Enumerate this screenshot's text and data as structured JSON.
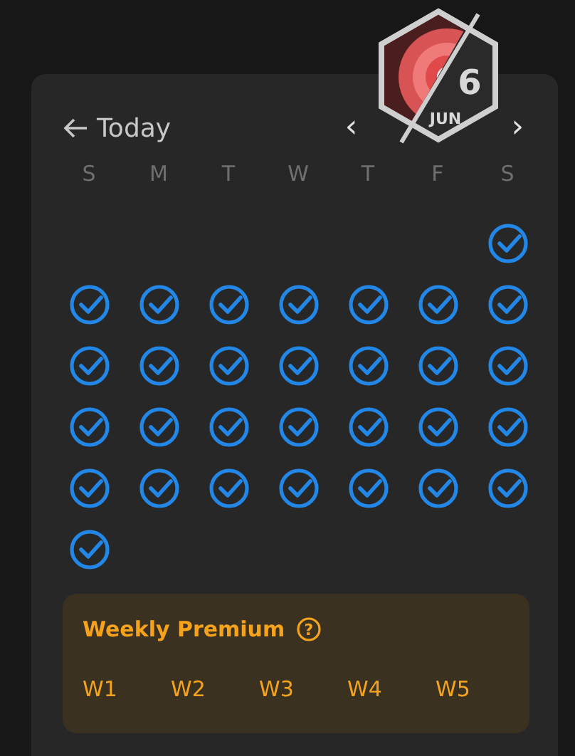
{
  "header": {
    "back_label": "Today",
    "prev": "‹",
    "next": "›"
  },
  "badge": {
    "day": "6",
    "month": "JUN"
  },
  "weekdays": [
    "S",
    "M",
    "T",
    "W",
    "T",
    "F",
    "S"
  ],
  "days": [
    {
      "kind": "blank"
    },
    {
      "kind": "blank"
    },
    {
      "kind": "blank"
    },
    {
      "kind": "blank"
    },
    {
      "kind": "blank"
    },
    {
      "kind": "blank"
    },
    {
      "kind": "day",
      "checked": true
    },
    {
      "kind": "day",
      "checked": true
    },
    {
      "kind": "day",
      "checked": true
    },
    {
      "kind": "day",
      "checked": true
    },
    {
      "kind": "day",
      "checked": true
    },
    {
      "kind": "day",
      "checked": true
    },
    {
      "kind": "day",
      "checked": true
    },
    {
      "kind": "day",
      "checked": true
    },
    {
      "kind": "day",
      "checked": true
    },
    {
      "kind": "day",
      "checked": true
    },
    {
      "kind": "day",
      "checked": true
    },
    {
      "kind": "day",
      "checked": true
    },
    {
      "kind": "day",
      "checked": true
    },
    {
      "kind": "day",
      "checked": true
    },
    {
      "kind": "day",
      "checked": true
    },
    {
      "kind": "day",
      "checked": true
    },
    {
      "kind": "day",
      "checked": true
    },
    {
      "kind": "day",
      "checked": true
    },
    {
      "kind": "day",
      "checked": true
    },
    {
      "kind": "day",
      "checked": true
    },
    {
      "kind": "day",
      "checked": true
    },
    {
      "kind": "day",
      "checked": true
    },
    {
      "kind": "day",
      "checked": true
    },
    {
      "kind": "day",
      "checked": true
    },
    {
      "kind": "day",
      "checked": true
    },
    {
      "kind": "day",
      "checked": true
    },
    {
      "kind": "day",
      "checked": true
    },
    {
      "kind": "day",
      "checked": true
    },
    {
      "kind": "day",
      "checked": true
    },
    {
      "kind": "day",
      "checked": true
    }
  ],
  "premium": {
    "title": "Weekly Premium",
    "help": "?",
    "weeks": [
      "W1",
      "W2",
      "W3",
      "W4",
      "W5"
    ]
  }
}
